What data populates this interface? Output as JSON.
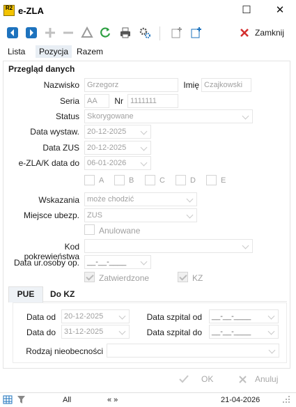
{
  "window": {
    "logo_text": "R2",
    "title": "e-ZLA",
    "maximize_glyph": "☐",
    "close_glyph": "✕"
  },
  "toolbar": {
    "close_label": "Zamknij"
  },
  "tabs": [
    "Lista",
    "Pozycja",
    "Razem"
  ],
  "section_title": "Przegląd danych",
  "form": {
    "nazwisko": {
      "label": "Nazwisko",
      "value": "Grzegorz"
    },
    "imie": {
      "label": "Imię",
      "value": "Czajkowski"
    },
    "seria": {
      "label": "Seria",
      "value": "AA"
    },
    "nr": {
      "label": "Nr",
      "value": "1111111"
    },
    "status": {
      "label": "Status",
      "value": "Skorygowane"
    },
    "data_wystaw": {
      "label": "Data wystaw.",
      "value": "20-12-2025"
    },
    "data_zus": {
      "label": "Data ZUS",
      "value": "20-12-2025"
    },
    "ezla_data_do": {
      "label": "e-ZLA/K data do",
      "value": "06-01-2026"
    },
    "codes": [
      "A",
      "B",
      "C",
      "D",
      "E"
    ],
    "wskazania": {
      "label": "Wskazania",
      "value": "może chodzić"
    },
    "miejsce": {
      "label": "Miejsce ubezp.",
      "value": "ZUS"
    },
    "anulowane": "Anulowane",
    "kod_pokrew": {
      "label": "Kod pokrewieństwa",
      "value": ""
    },
    "data_ur": {
      "label": "Data ur.osoby op.",
      "value": "__-__-____"
    },
    "zatwierdzone": "Zatwierdzone",
    "kz": "KZ"
  },
  "subtabs": [
    "PUE",
    "Do KZ"
  ],
  "period": {
    "data_od": {
      "label": "Data od",
      "value": "20-12-2025"
    },
    "data_do": {
      "label": "Data do",
      "value": "31-12-2025"
    },
    "szpital_od": {
      "label": "Data szpital od",
      "value": "__-__-____"
    },
    "szpital_do": {
      "label": "Data szpital do",
      "value": "__-__-____"
    },
    "rodzaj": {
      "label": "Rodzaj nieobecności",
      "value": ""
    }
  },
  "buttons": {
    "ok": "OK",
    "anuluj": "Anuluj"
  },
  "statusbar": {
    "filter": "All",
    "nav": "« »",
    "date": "21-04-2026"
  },
  "colors": {
    "accent": "#1e73be",
    "green": "#2ea043",
    "red": "#d32f2f"
  }
}
